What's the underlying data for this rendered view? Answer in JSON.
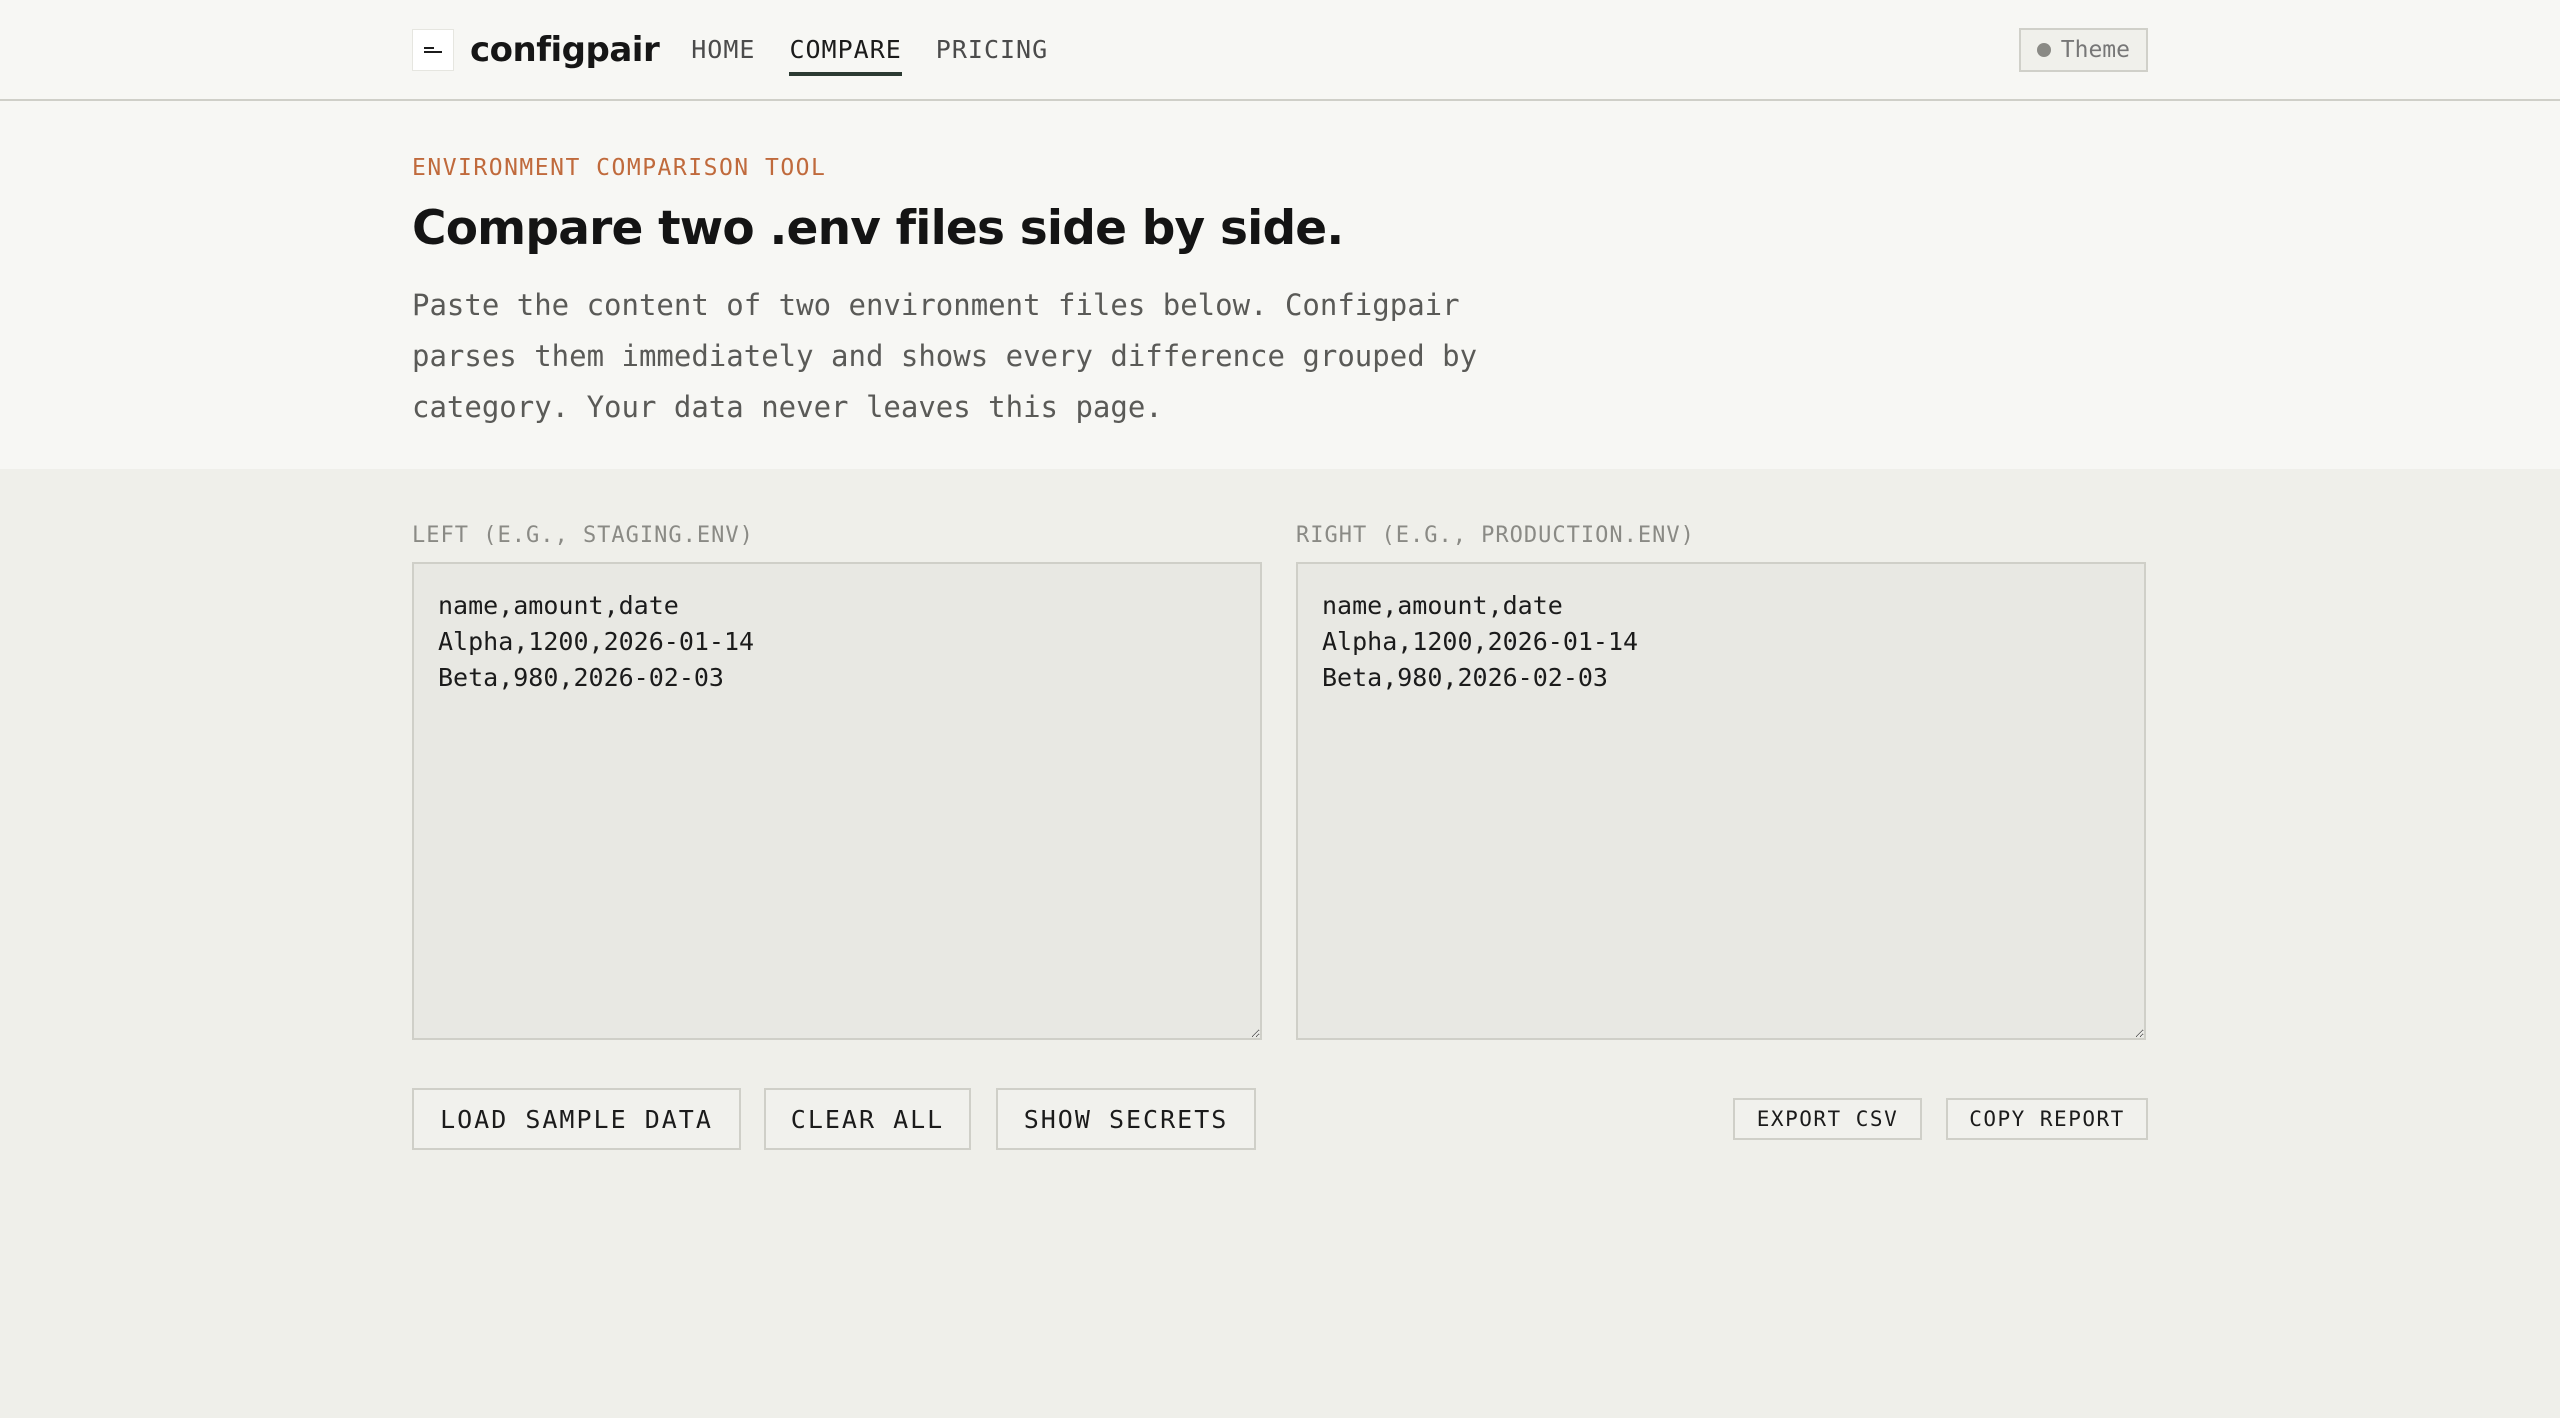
{
  "header": {
    "brand": "configpair",
    "nav": [
      {
        "label": "HOME",
        "active": false
      },
      {
        "label": "COMPARE",
        "active": true
      },
      {
        "label": "PRICING",
        "active": false
      }
    ],
    "theme_label": "Theme"
  },
  "hero": {
    "eyebrow": "ENVIRONMENT COMPARISON TOOL",
    "title": "Compare two .env files side by side.",
    "description": "Paste the content of two environment files below. Configpair parses them immediately and shows every difference grouped by category. Your data never leaves this page."
  },
  "editors": {
    "left": {
      "label": "LEFT (E.G., STAGING.ENV)",
      "value": "name,amount,date\nAlpha,1200,2026-01-14\nBeta,980,2026-02-03"
    },
    "right": {
      "label": "RIGHT (E.G., PRODUCTION.ENV)",
      "value": "name,amount,date\nAlpha,1200,2026-01-14\nBeta,980,2026-02-03"
    }
  },
  "actions": {
    "load_sample": "LOAD SAMPLE DATA",
    "clear_all": "CLEAR ALL",
    "show_secrets": "SHOW SECRETS",
    "export_csv": "EXPORT CSV",
    "copy_report": "COPY REPORT"
  },
  "colors": {
    "accent": "#c06a3c",
    "nav_underline": "#2c3a32",
    "background": "#efefea",
    "surface": "#f7f7f4"
  }
}
